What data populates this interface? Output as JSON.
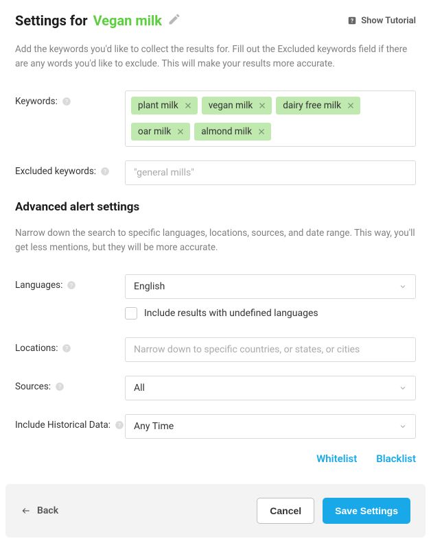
{
  "header": {
    "title_prefix": "Settings for",
    "title_name": "Vegan milk",
    "tutorial_label": "Show Tutorial"
  },
  "intro": "Add the keywords you'd like to collect the results for. Fill out the Excluded keywords field if there are any words you'd like to exclude. This will make your results more accurate.",
  "keywords": {
    "label": "Keywords:",
    "tags": [
      "plant milk",
      "vegan milk",
      "dairy free milk",
      "oar milk",
      "almond milk"
    ]
  },
  "excluded": {
    "label": "Excluded keywords:",
    "placeholder": "\"general mills\""
  },
  "advanced": {
    "heading": "Advanced alert settings",
    "intro": "Narrow down the search to specific languages, locations, sources, and date range. This way, you'll get less mentions, but they will be more accurate.",
    "languages": {
      "label": "Languages:",
      "value": "English"
    },
    "undefined_lang_checkbox": "Include results with undefined languages",
    "locations": {
      "label": "Locations:",
      "placeholder": "Narrow down to specific countries, or states, or cities"
    },
    "sources": {
      "label": "Sources:",
      "value": "All"
    },
    "historical": {
      "label": "Include Historical Data:",
      "value": "Any Time"
    },
    "links": {
      "whitelist": "Whitelist",
      "blacklist": "Blacklist"
    }
  },
  "footer": {
    "back": "Back",
    "cancel": "Cancel",
    "save": "Save Settings"
  }
}
